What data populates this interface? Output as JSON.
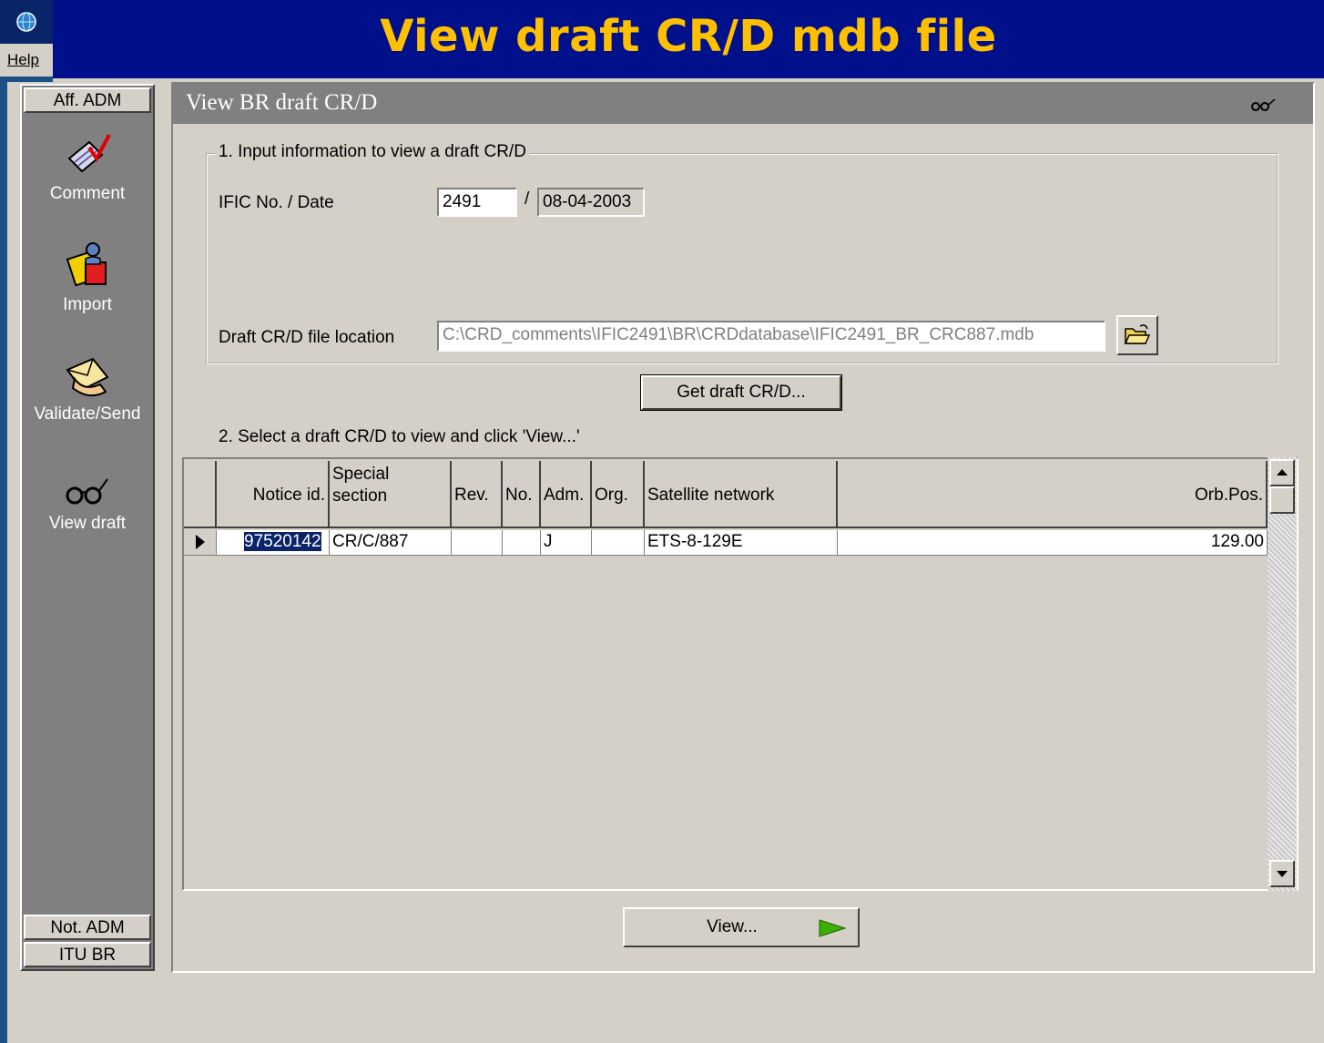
{
  "banner": {
    "title": "View draft CR/D mdb file"
  },
  "menubar": {
    "help": "Help"
  },
  "sidebar": {
    "top_button": "Aff. ADM",
    "items": [
      {
        "label": "Comment",
        "icon": "comment-icon"
      },
      {
        "label": "Import",
        "icon": "import-icon"
      },
      {
        "label": "Validate/Send",
        "icon": "validate-send-icon"
      },
      {
        "label": "View draft",
        "icon": "glasses-icon"
      }
    ],
    "bottom_buttons": [
      "Not. ADM",
      "ITU BR"
    ]
  },
  "panel": {
    "title": "View BR draft CR/D"
  },
  "group1": {
    "legend": "1. Input information to view a draft CR/D",
    "ific_label": "IFIC No. / Date",
    "ific_no": "2491",
    "separator": "/",
    "ific_date": "08-04-2003",
    "file_label": "Draft CR/D file location",
    "file_path": "C:\\CRD_comments\\IFIC2491\\BR\\CRDdatabase\\IFIC2491_BR_CRC887.mdb"
  },
  "get_button": "Get draft CR/D...",
  "section2_label": "2. Select a draft CR/D to view and click 'View...'",
  "grid": {
    "headers": [
      "Notice id.",
      "Special section",
      "Rev.",
      "No.",
      "Adm.",
      "Org.",
      "Satellite network",
      "Orb.Pos."
    ],
    "rows": [
      {
        "notice_id": "97520142",
        "special_section": "CR/C/887",
        "rev": "",
        "no": "",
        "adm": "J",
        "org": "",
        "satellite_network": "ETS-8-129E",
        "orb_pos": "129.00"
      }
    ]
  },
  "view_button": "View...",
  "colors": {
    "banner_bg": "#000f8a",
    "banner_text": "#ffc000",
    "panel_gray": "#d4d0c8",
    "title_gray": "#808080",
    "accent_green": "#3cb000"
  }
}
